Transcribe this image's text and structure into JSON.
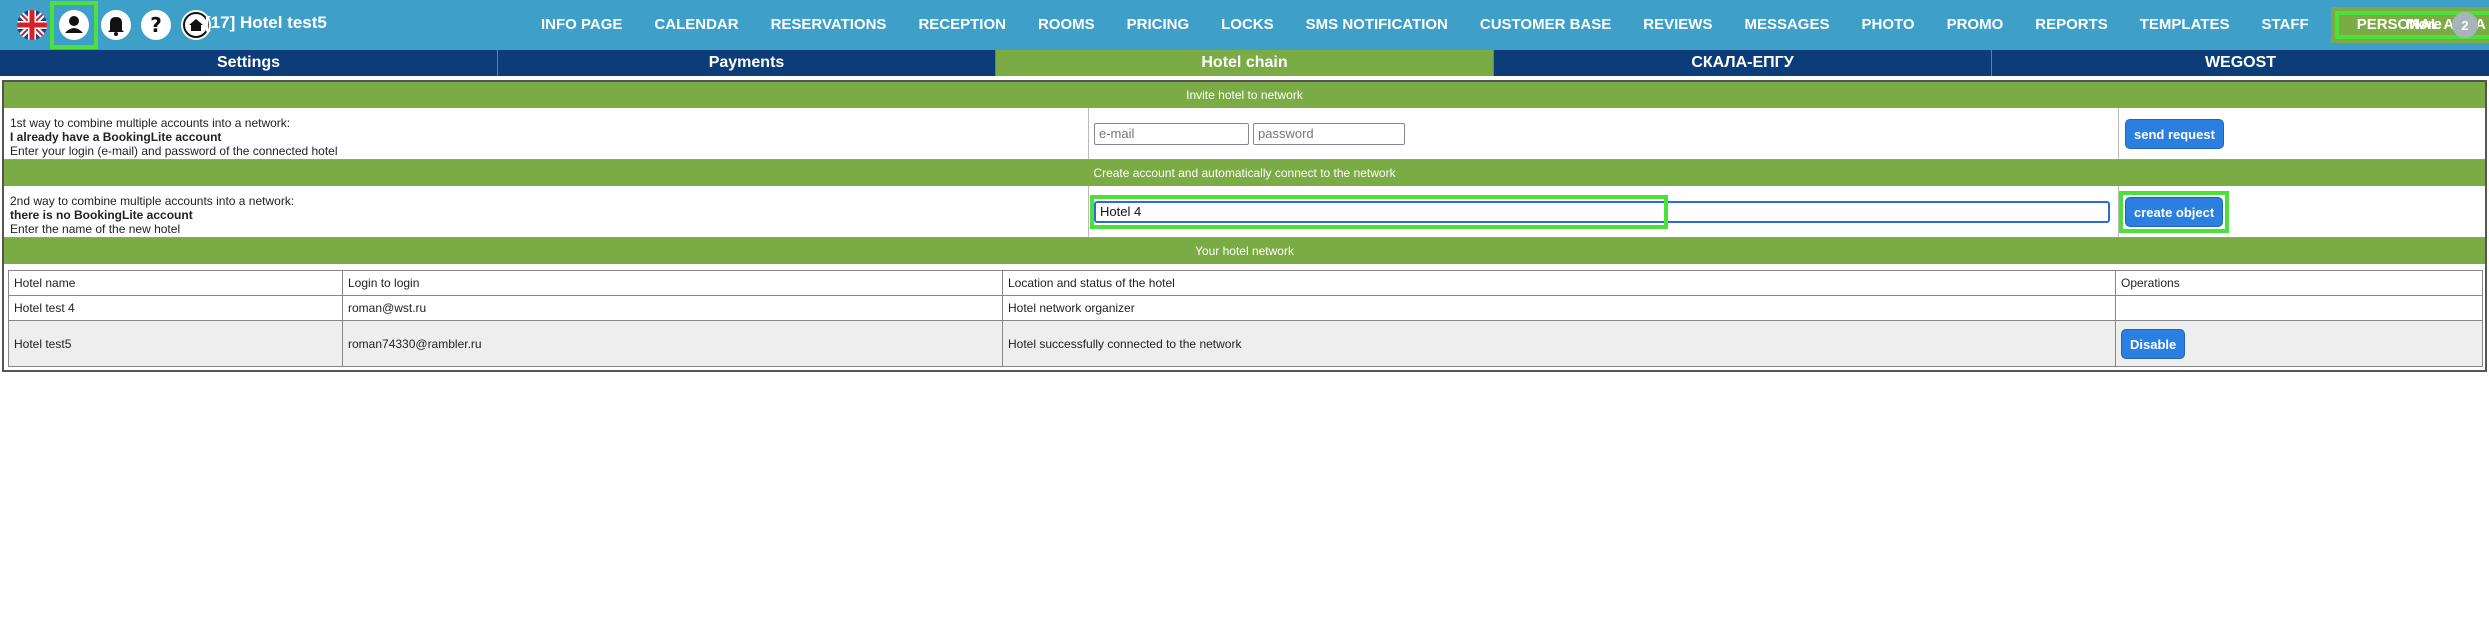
{
  "topbar": {
    "icons": [
      "uk-flag-icon",
      "user-icon",
      "bell-icon",
      "help-icon",
      "home-icon"
    ],
    "hotel_title": "[17] Hotel test5",
    "nav": [
      "INFO PAGE",
      "CALENDAR",
      "RESERVATIONS",
      "RECEPTION",
      "ROOMS",
      "PRICING",
      "LOCKS",
      "SMS NOTIFICATION",
      "CUSTOMER BASE",
      "REVIEWS",
      "MESSAGES",
      "PHOTO",
      "PROMO",
      "REPORTS",
      "TEMPLATES",
      "STAFF",
      "PERSONAL AREA"
    ],
    "active_nav": "PERSONAL AREA",
    "more_label": "More",
    "badge_count": "2"
  },
  "subtabs": [
    "Settings",
    "Payments",
    "Hotel chain",
    "СКАЛА-ЕПГУ",
    "WEGOST"
  ],
  "active_subtab": "Hotel chain",
  "invite": {
    "header": "Invite hotel to network",
    "line1": "1st way to combine multiple accounts into a network:",
    "line2": "I already have a BookingLite account",
    "line3": "Enter your login (e-mail) and password of the connected hotel",
    "email_placeholder": "e-mail",
    "password_placeholder": "password",
    "button": "send request"
  },
  "create": {
    "header": "Create account and automatically connect to the network",
    "line1": "2nd way to combine multiple accounts into a network:",
    "line2": "there is no BookingLite account",
    "line3": "Enter the name of the new hotel",
    "name_value": "Hotel 4",
    "button": "create object"
  },
  "network": {
    "header": "Your hotel network",
    "columns": [
      "Hotel name",
      "Login to login",
      "Location and status of the hotel",
      "Operations"
    ],
    "rows": [
      {
        "name": "Hotel test 4",
        "login": "roman@wst.ru",
        "status": "Hotel network organizer",
        "operation": ""
      },
      {
        "name": "Hotel test5",
        "login": "roman74330@rambler.ru",
        "status": "Hotel successfully connected to the network",
        "operation": "Disable"
      }
    ]
  },
  "colors": {
    "topbar": "#3ea0c8",
    "subtabs": "#0d3d78",
    "accent_green": "#7bab44",
    "button_blue": "#2a7fe0",
    "highlight": "#4be13a"
  }
}
